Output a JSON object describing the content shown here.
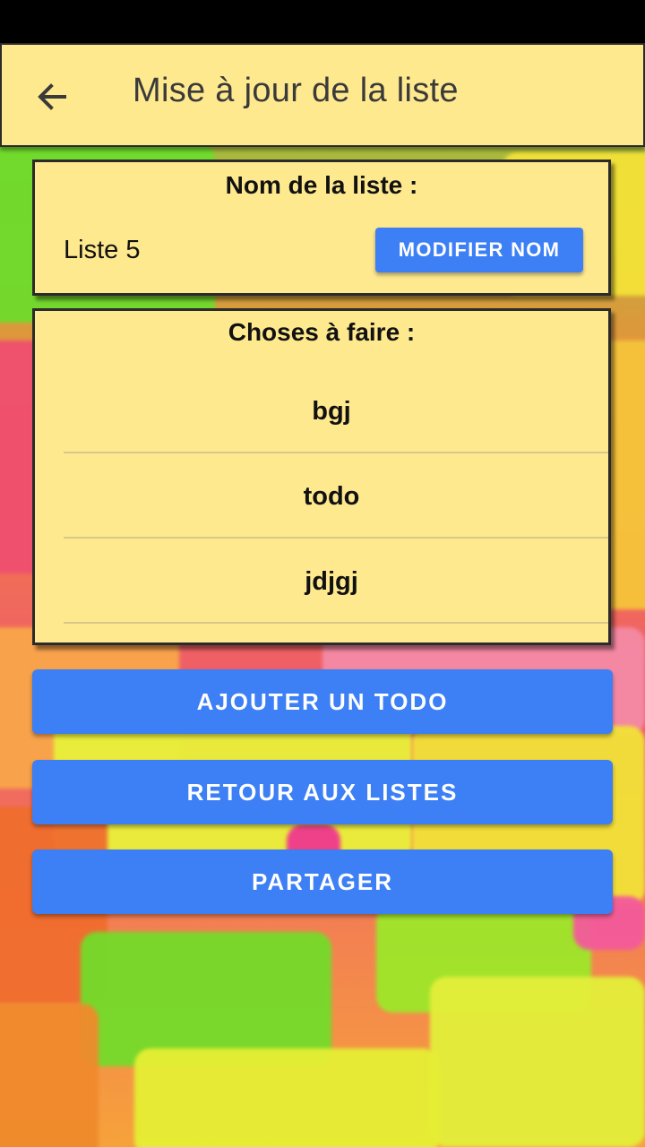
{
  "app_bar": {
    "title": "Mise à jour de la liste",
    "back_icon": "arrow-left-icon"
  },
  "name_card": {
    "heading": "Nom de la liste :",
    "list_name": "Liste 5",
    "modify_label": "MODIFIER NOM"
  },
  "todos_card": {
    "heading": "Choses à faire :",
    "items": [
      "bgj",
      "todo",
      "jdjgj"
    ]
  },
  "actions": {
    "add_todo_label": "AJOUTER UN TODO",
    "back_to_lists_label": "RETOUR AUX LISTES",
    "share_label": "PARTAGER"
  },
  "colors": {
    "card_background": "#ffe98f",
    "button_blue": "#3d7ff5",
    "status_bar": "#000000"
  }
}
